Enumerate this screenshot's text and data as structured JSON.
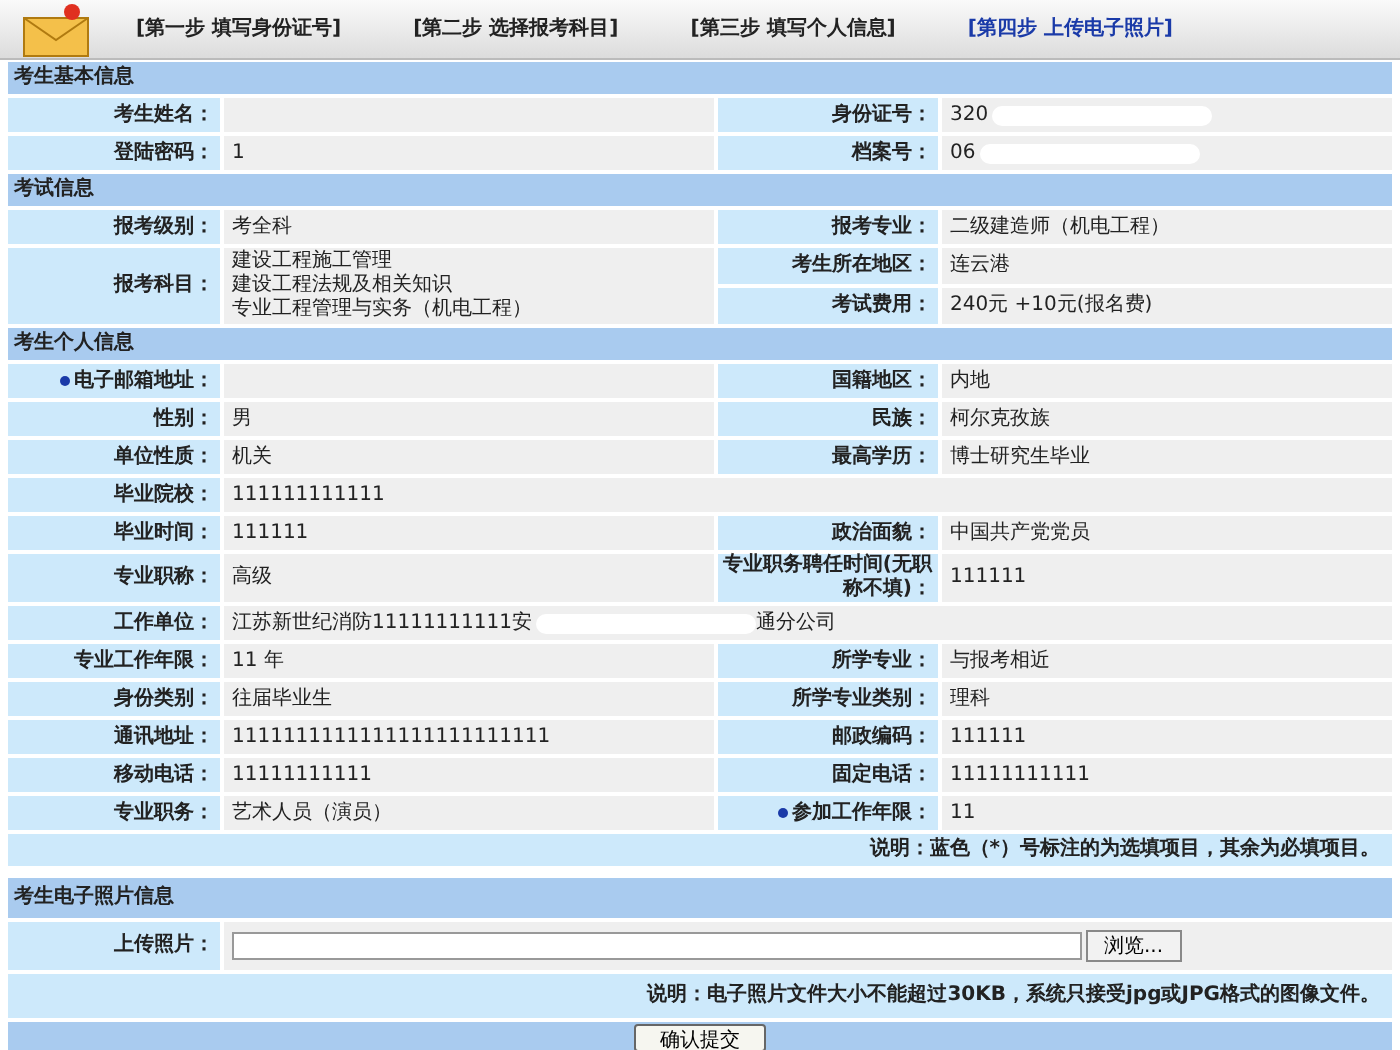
{
  "steps": [
    {
      "label": "[第一步  填写身份证号]",
      "selected": false
    },
    {
      "label": "[第二步  选择报考科目]",
      "selected": false
    },
    {
      "label": "[第三步  填写个人信息]",
      "selected": false
    },
    {
      "label": "[第四步  上传电子照片]",
      "selected": true
    }
  ],
  "sections": [
    {
      "title": "考生基本信息",
      "rows": [
        {
          "fields": [
            {
              "label": "考生姓名："
            },
            {
              "label": "身份证号：",
              "value": "320",
              "redacted": true
            }
          ]
        },
        {
          "fields": [
            {
              "label": "登陆密码：",
              "value": "1"
            },
            {
              "label": "档案号：",
              "value": "06",
              "redacted": true
            }
          ]
        }
      ]
    },
    {
      "title": "考试信息",
      "rows": [
        {
          "fields": [
            {
              "label": "报考级别：",
              "value": "考全科"
            },
            {
              "label": "报考专业：",
              "value": "二级建造师（机电工程）"
            }
          ]
        },
        {
          "fields": [
            {
              "label": "报考科目：",
              "lines": [
                "建设工程施工管理",
                "建设工程法规及相关知识",
                "专业工程管理与实务（机电工程）"
              ]
            },
            {
              "kind": "stack",
              "fields": [
                {
                  "label": "考生所在地区：",
                  "value": "连云港"
                },
                {
                  "label": "考试费用：",
                  "value": "240元  +10元(报名费)"
                }
              ]
            }
          ]
        }
      ]
    },
    {
      "title": "考生个人信息",
      "rows": [
        {
          "fields": [
            {
              "label": "电子邮箱地址：",
              "optional": true
            },
            {
              "label": "国籍地区：",
              "value": "内地"
            }
          ]
        },
        {
          "fields": [
            {
              "label": "性别：",
              "value": "男"
            },
            {
              "label": "民族：",
              "value": "柯尔克孜族"
            }
          ]
        },
        {
          "fields": [
            {
              "label": "单位性质：",
              "value": "机关"
            },
            {
              "label": "最高学历：",
              "value": "博士研究生毕业"
            }
          ]
        },
        {
          "fields": [
            {
              "label": "毕业院校：",
              "value": "111111111111",
              "wide": true
            }
          ]
        },
        {
          "fields": [
            {
              "label": "毕业时间：",
              "value": "111111"
            },
            {
              "label": "政治面貌：",
              "value": "中国共产党党员"
            }
          ]
        },
        {
          "fields": [
            {
              "label": "专业职称：",
              "value": "高级"
            },
            {
              "label": "专业职务聘任时间(无职称不填)：",
              "value": "111111"
            }
          ]
        },
        {
          "fields": [
            {
              "label": "工作单位：",
              "value": "江苏新世纪消防11111111111安",
              "tail": "通分公司",
              "redacted": true,
              "wide": true
            }
          ]
        },
        {
          "fields": [
            {
              "label": "专业工作年限：",
              "value": "11 年"
            },
            {
              "label": "所学专业：",
              "value": "与报考相近"
            }
          ]
        },
        {
          "fields": [
            {
              "label": "身份类别：",
              "value": "往届毕业生"
            },
            {
              "label": "所学专业类别：",
              "value": "理科"
            }
          ]
        },
        {
          "fields": [
            {
              "label": "通讯地址：",
              "value": "1111111111111111111111111"
            },
            {
              "label": "邮政编码：",
              "value": "111111"
            }
          ]
        },
        {
          "fields": [
            {
              "label": "移动电话：",
              "value": "11111111111"
            },
            {
              "label": "固定电话：",
              "value": "11111111111"
            }
          ]
        },
        {
          "fields": [
            {
              "label": "专业职务：",
              "value": "艺术人员（演员）"
            },
            {
              "label": "参加工作年限：",
              "value": "11",
              "optional": true
            }
          ]
        }
      ],
      "note": "说明：蓝色（*）号标注的为选填项目，其余为必填项目。"
    }
  ],
  "photo": {
    "title": "考生电子照片信息",
    "label": "上传照片：",
    "browse": "浏览...",
    "note": "说明：电子照片文件大小不能超过30KB，系统只接受jpg或JPG格式的图像文件。"
  },
  "submit": "确认提交"
}
